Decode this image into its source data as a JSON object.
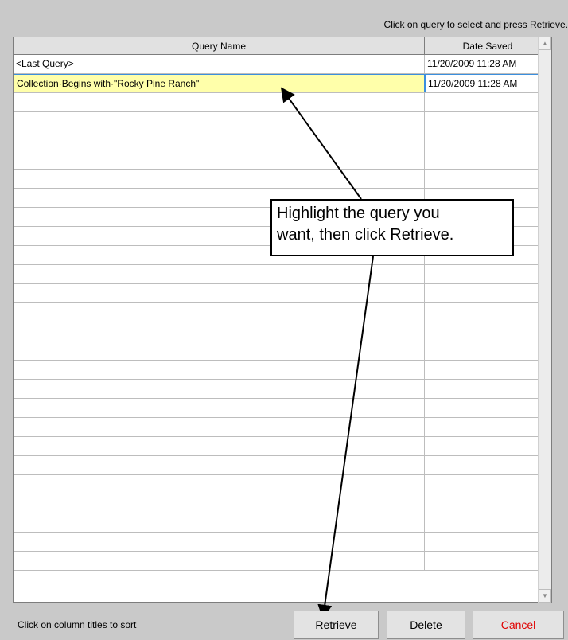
{
  "instruction": "Click on query to select and press Retrieve.",
  "columns": {
    "name": "Query Name",
    "date": "Date Saved"
  },
  "rows": [
    {
      "name": "<Last Query>",
      "date": "11/20/2009 11:28 AM"
    },
    {
      "name": "Collection·Begins with·\"Rocky Pine Ranch\"",
      "date": "11/20/2009 11:28 AM"
    }
  ],
  "selected_row": 1,
  "callout": {
    "line1": "Highlight the query you",
    "line2": "want, then click Retrieve."
  },
  "footer_hint": "Click on column titles to sort",
  "buttons": {
    "retrieve": "Retrieve",
    "delete": "Delete",
    "cancel": "Cancel"
  },
  "colors": {
    "selected_row_bg": "#ffffaa",
    "selected_row_border": "#3b8fde",
    "cancel_text": "#e00000"
  },
  "icons": {
    "scroll_up": "triangle-up",
    "scroll_down": "triangle-down"
  }
}
